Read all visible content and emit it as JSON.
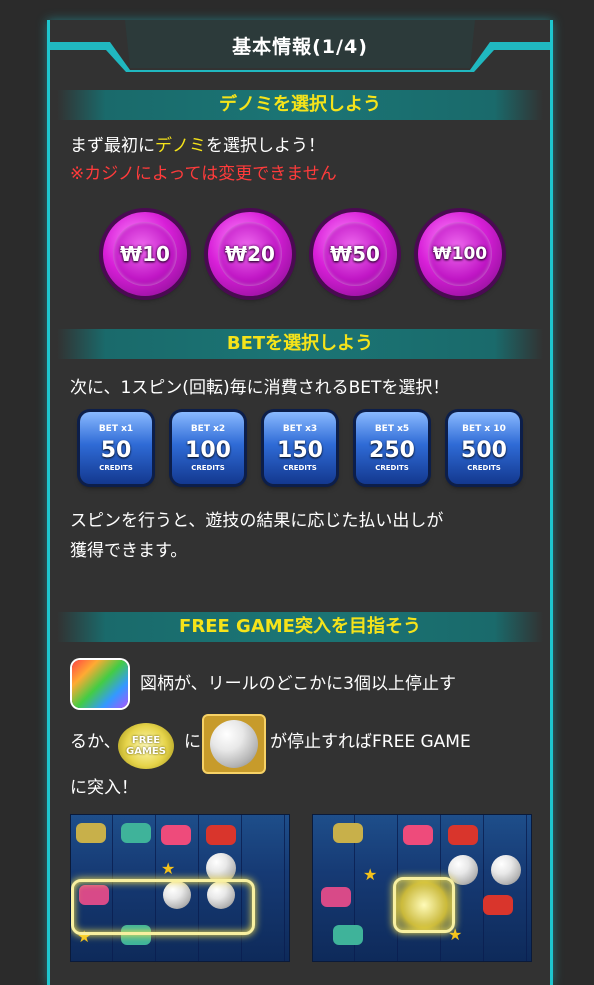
{
  "header": {
    "title": "基本情報(1/4)"
  },
  "sections": [
    {
      "title": "デノミを選択しよう"
    },
    {
      "title": "BETを選択しよう"
    },
    {
      "title": "FREE GAME突入を目指そう"
    }
  ],
  "denomination": {
    "line1_pre": "まず最初に",
    "line1_hl": "デノミ",
    "line1_post": "を選択しよう！",
    "note": "※カジノによっては変更できません",
    "coins": [
      "₩10",
      "₩20",
      "₩50",
      "₩100"
    ]
  },
  "bet": {
    "intro": "次に、1スピン(回転)毎に消費されるBETを選択！",
    "options": [
      {
        "mult": "BET x1",
        "credits": "50",
        "unit": "CREDITS"
      },
      {
        "mult": "BET x2",
        "credits": "100",
        "unit": "CREDITS"
      },
      {
        "mult": "BET x3",
        "credits": "150",
        "unit": "CREDITS"
      },
      {
        "mult": "BET x5",
        "credits": "250",
        "unit": "CREDITS"
      },
      {
        "mult": "BET x 10",
        "credits": "500",
        "unit": "CREDITS"
      }
    ],
    "result_line1": "スピンを行うと、遊技の結果に応じた払い出しが",
    "result_line2": "獲得できます。"
  },
  "free_game": {
    "line1": "図柄が、リールのどこかに3個以上停止す",
    "line2_pre": "るか、",
    "line2_mid": "に",
    "line2_post": "が停止すればFREE GAME",
    "line3": "に突入！",
    "fg_icon_text1": "FREE",
    "fg_icon_text2": "GAMES"
  },
  "colors": {
    "accent": "#1ec6cf",
    "heading": "#f5e31a",
    "warning": "#ff3b3b"
  }
}
